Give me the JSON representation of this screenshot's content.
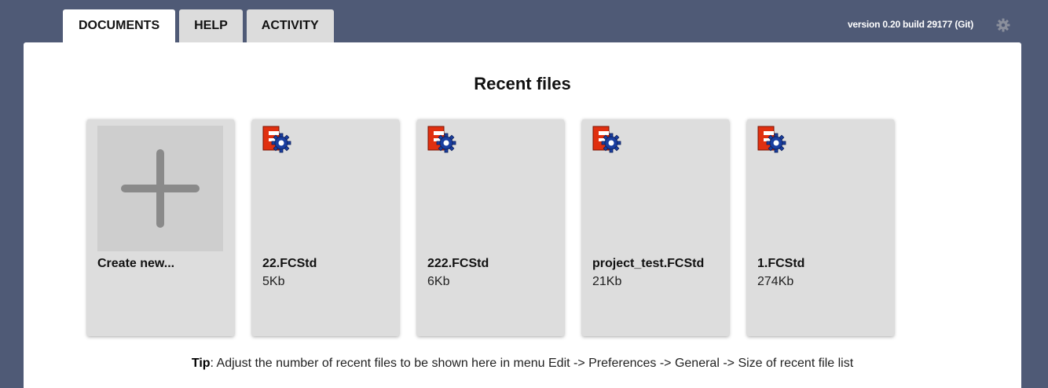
{
  "tabs": [
    {
      "label": "DOCUMENTS",
      "active": true
    },
    {
      "label": "HELP",
      "active": false
    },
    {
      "label": "ACTIVITY",
      "active": false
    }
  ],
  "header": {
    "version": "version 0.20 build 29177 (Git)",
    "settings_icon": "gear-icon"
  },
  "main": {
    "title": "Recent files",
    "create_new_label": "Create new...",
    "files": [
      {
        "name": "22.FCStd",
        "size": "5Kb",
        "icon": "freecad-file-icon"
      },
      {
        "name": "222.FCStd",
        "size": "6Kb",
        "icon": "freecad-file-icon"
      },
      {
        "name": "project_test.FCStd",
        "size": "21Kb",
        "icon": "freecad-file-icon"
      },
      {
        "name": "1.FCStd",
        "size": "274Kb",
        "icon": "freecad-file-icon"
      }
    ],
    "tip_label": "Tip",
    "tip_text": ": Adjust the number of recent files to be shown here in menu Edit -> Preferences -> General -> Size of recent file list"
  },
  "colors": {
    "background": "#4f5a76",
    "card": "#dddddd",
    "icon_red": "#e03010",
    "icon_blue": "#1a3fa0"
  }
}
